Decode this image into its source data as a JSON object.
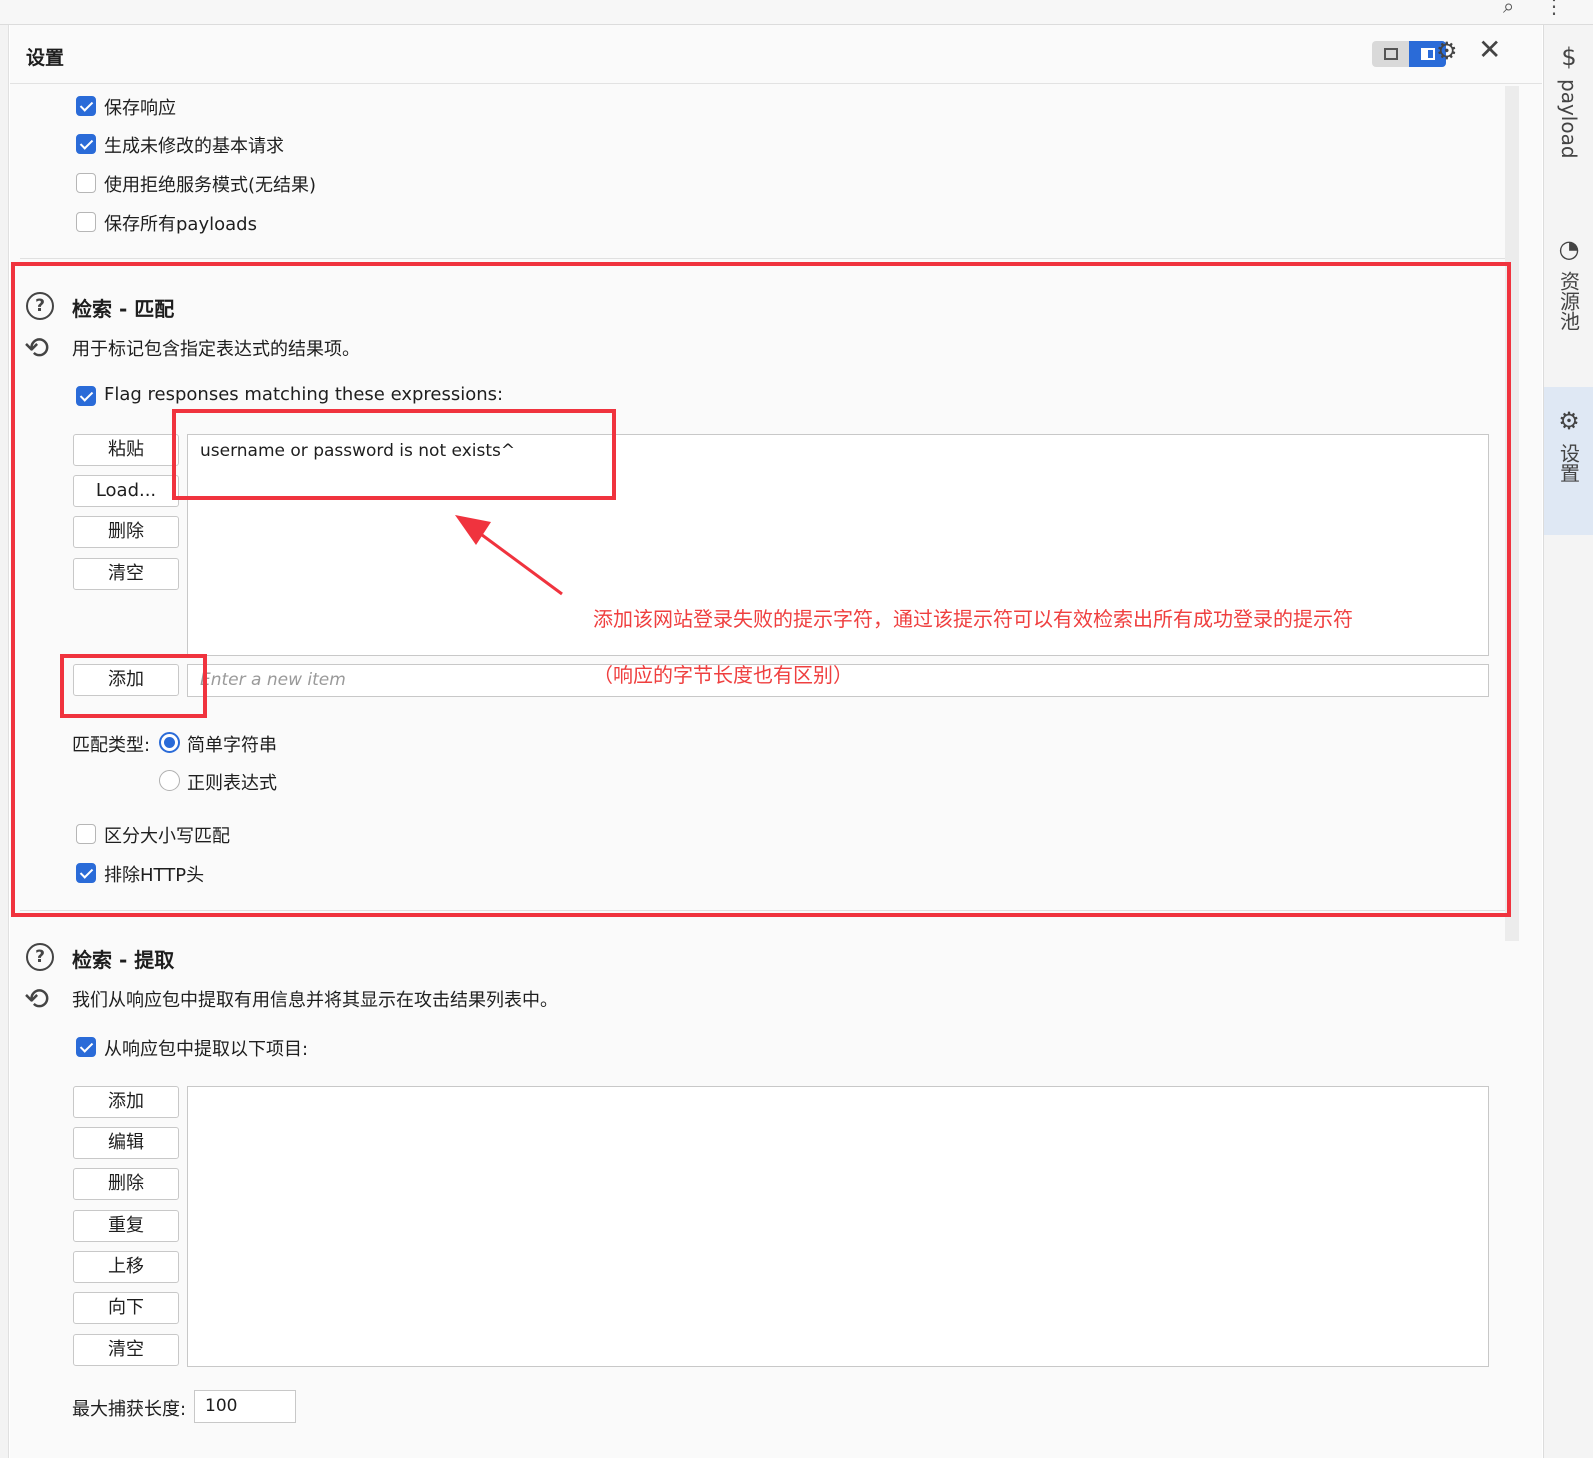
{
  "header": {
    "title": "设置"
  },
  "top_options": [
    {
      "label": "保存响应",
      "checked": true
    },
    {
      "label": "生成未修改的基本请求",
      "checked": true
    },
    {
      "label": "使用拒绝服务模式(无结果)",
      "checked": false
    },
    {
      "label": "保存所有payloads",
      "checked": false
    }
  ],
  "grep_match": {
    "title": "检索 - 匹配",
    "description": "用于标记包含指定表达式的结果项。",
    "flag_label": "Flag responses matching these expressions:",
    "flag_checked": true,
    "buttons": {
      "paste": "粘贴",
      "load": "Load...",
      "remove": "删除",
      "clear": "清空",
      "add": "添加"
    },
    "items": [
      "username or password is not exists^"
    ],
    "new_item_placeholder": "Enter a new item",
    "match_type_label": "匹配类型:",
    "match_types": [
      {
        "label": "简单字符串",
        "selected": true
      },
      {
        "label": "正则表达式",
        "selected": false
      }
    ],
    "case_sensitive": {
      "label": "区分大小写匹配",
      "checked": false
    },
    "exclude_http_headers": {
      "label": "排除HTTP头",
      "checked": true
    }
  },
  "grep_extract": {
    "title": "检索 - 提取",
    "description": "我们从响应包中提取有用信息并将其显示在攻击结果列表中。",
    "extract_label": "从响应包中提取以下项目:",
    "extract_checked": true,
    "buttons": {
      "add": "添加",
      "edit": "编辑",
      "remove": "删除",
      "duplicate": "重复",
      "up": "上移",
      "down": "向下",
      "clear": "清空"
    },
    "max_capture_label": "最大捕获长度:",
    "max_capture_value": "100"
  },
  "annotation": {
    "line1": "添加该网站登录失败的提示字符，通过该提示符可以有效检索出所有成功登录的提示符",
    "line2": "（响应的字节长度也有区别）",
    "color": "#ef3f3f"
  },
  "right_sidebar": {
    "tabs": [
      {
        "label": "payload",
        "icon": "dollar-icon",
        "active": false
      },
      {
        "label": "资源池",
        "icon": "pie-chart-icon",
        "active": false
      },
      {
        "label": "设置",
        "icon": "gear-icon",
        "active": true
      }
    ]
  },
  "colors": {
    "accent": "#2a6bd8",
    "highlight_red": "#f0333e"
  }
}
